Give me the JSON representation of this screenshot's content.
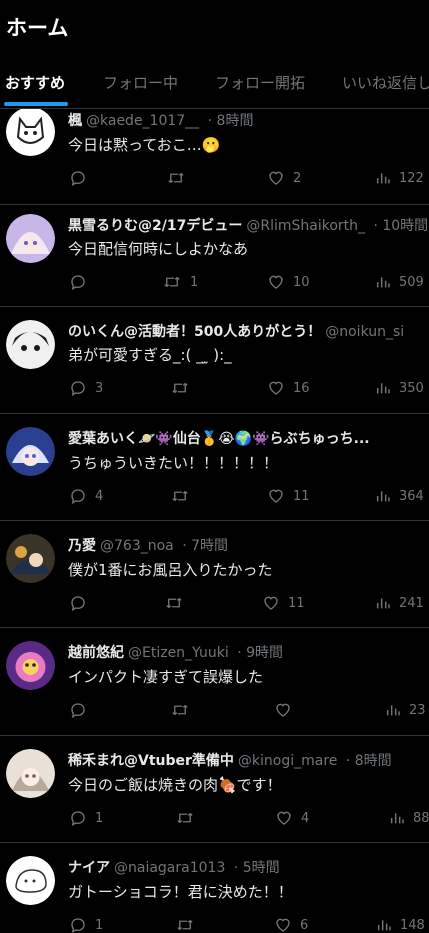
{
  "header": {
    "title": "ホーム",
    "tabs": [
      {
        "label": "おすすめ"
      },
      {
        "label": "フォロー中"
      },
      {
        "label": "フォロー開拓"
      },
      {
        "label": "いいね返信し"
      }
    ]
  },
  "tweets": [
    {
      "name": "楓",
      "handle": "@kaede_1017__",
      "time": "· 8時間",
      "text": "今日は黙っておこ…🫢",
      "replies": "",
      "retweets": "",
      "likes": "2",
      "views": "122"
    },
    {
      "name": "黒雪るりむ@2/17デビュー",
      "handle": "@RlimShaikorth_",
      "time": "· 10時間",
      "text": "今日配信何時にしよかなあ",
      "replies": "",
      "retweets": "1",
      "likes": "10",
      "views": "509"
    },
    {
      "name": "のいくん@活動者！500人ありがとう！",
      "handle": "@noikun_si",
      "time": "",
      "text": "弟が可愛すぎる_:(   _ ̫ ):_",
      "replies": "3",
      "retweets": "",
      "likes": "16",
      "views": "350"
    },
    {
      "name": "愛葉あいく🪐👾仙台🥇😭🌍👾らぶちゅっち...",
      "handle": "",
      "time": "",
      "text": "うちゅういきたい！！！！！！",
      "replies": "4",
      "retweets": "",
      "likes": "11",
      "views": "364"
    },
    {
      "name": "乃愛",
      "handle": "@763_noa",
      "time": "· 7時間",
      "text": "僕が1番にお風呂入りたかった",
      "replies": "",
      "retweets": "",
      "likes": "11",
      "views": "241"
    },
    {
      "name": "越前悠紀",
      "handle": "@Etizen_Yuuki",
      "time": "· 9時間",
      "text": "インパクト凄すぎて誤爆した",
      "replies": "",
      "retweets": "",
      "likes": "",
      "views": "23"
    },
    {
      "name": "稀禾まれ@Vtuber準備中",
      "handle": "@kinogi_mare",
      "time": "· 8時間",
      "text": "今日のご飯は焼きの肉🍖です！",
      "replies": "1",
      "retweets": "",
      "likes": "4",
      "views": "88"
    },
    {
      "name": "ナイア",
      "handle": "@naiagara1013",
      "time": "· 5時間",
      "text": "ガトーショコラ！君に決めた！！",
      "replies": "1",
      "retweets": "",
      "likes": "6",
      "views": "148"
    }
  ],
  "colors": {
    "accent": "#1d9bf0",
    "muted": "#71767b",
    "divider": "#2f3336"
  }
}
